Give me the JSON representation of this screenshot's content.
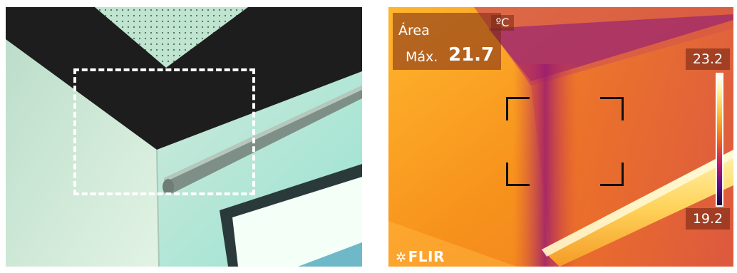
{
  "thermal": {
    "measurement": {
      "label": "Área",
      "max_label": "Máx.",
      "max_value": "21.7"
    },
    "unit": "ºC",
    "scale": {
      "max": "23.2",
      "min": "19.2"
    },
    "brand": {
      "icon": "flir-logo-icon",
      "text": "FLIR"
    }
  },
  "photo": {
    "roi": "dashed-selection-rectangle"
  }
}
